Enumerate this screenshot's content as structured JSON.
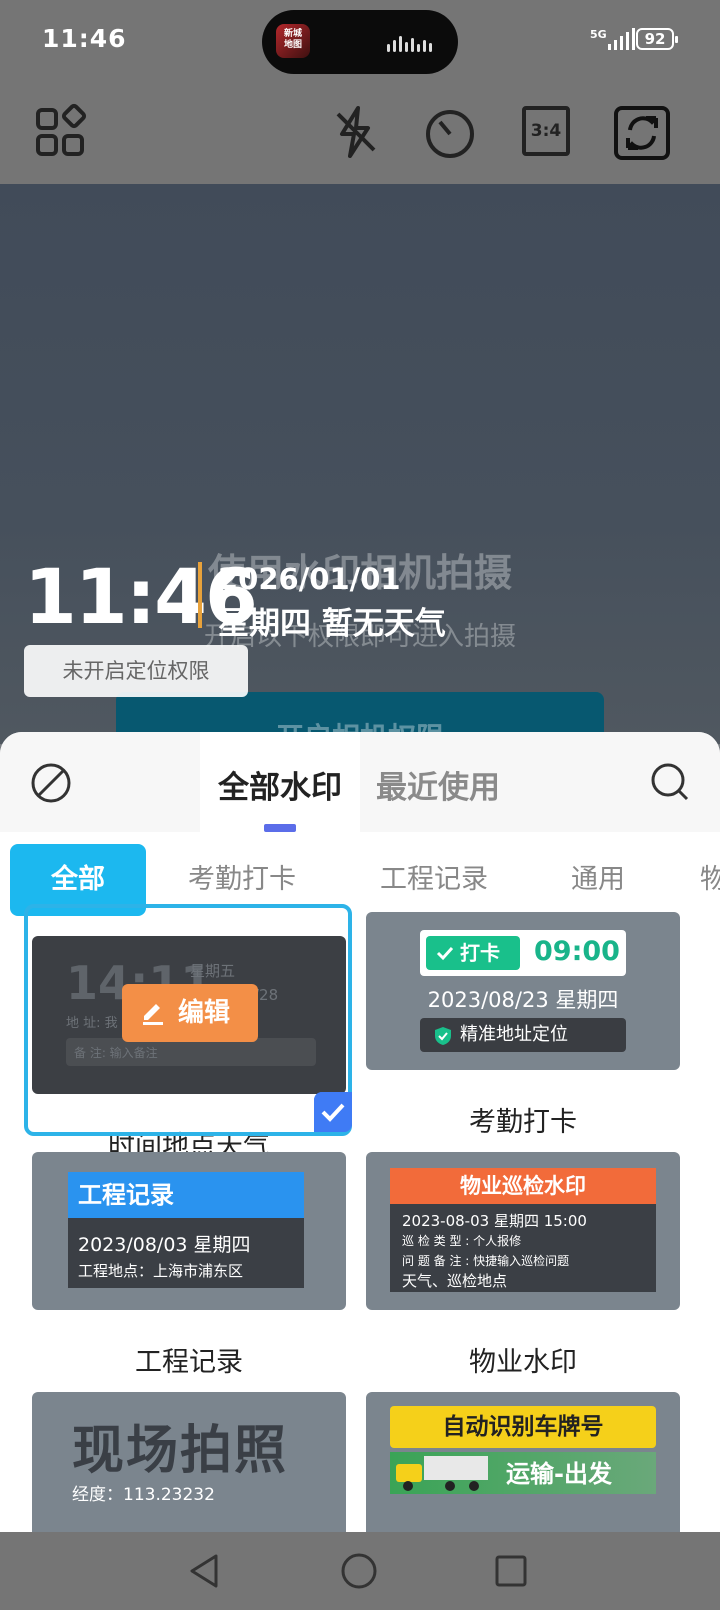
{
  "status_bar": {
    "time": "11:46",
    "network": "5G",
    "battery": "92",
    "island_app": "新城\n地图"
  },
  "camera": {
    "permission_title": "使用水印相机拍摄",
    "permission_subtitle": "开启以下权限即可进入拍摄",
    "permission_button": "开启相机权限",
    "ratio": "3:4"
  },
  "watermark": {
    "time": "11:46",
    "date": "2026/01/01",
    "weekday_weather": "星期四 暂无天气",
    "location": "未开启定位权限"
  },
  "sheet": {
    "tabs": [
      "全部水印",
      "最近使用"
    ],
    "categories": [
      "全部",
      "考勤打卡",
      "工程记录",
      "通用",
      "物"
    ],
    "cards": [
      {
        "label": "时间地点天气",
        "thumb": {
          "time": "14:11",
          "weekday": "星期五",
          "date": "/28",
          "address": "地 址: 我",
          "note": "备 注: 输入备注",
          "edit": "编辑"
        }
      },
      {
        "label": "考勤打卡",
        "thumb": {
          "tag": "打卡",
          "time": "09:00",
          "date": "2023/08/23 星期四",
          "location": "精准地址定位"
        }
      },
      {
        "label": "工程记录",
        "thumb": {
          "header": "工程记录",
          "date": "2023/08/03   星期四",
          "address": "工程地点：上海市浦东区"
        }
      },
      {
        "label": "物业水印",
        "thumb": {
          "header": "物业巡检水印",
          "line1": "2023-08-03 星期四 15:00",
          "line2": "巡 检 类 型 : 个人报修",
          "line3": "问 题 备 注 : 快捷输入巡检问题",
          "line4": "天气、巡检地点"
        }
      },
      {
        "label": "",
        "thumb": {
          "title": "现场拍照",
          "longitude": "经度：113.23232"
        }
      },
      {
        "label": "",
        "thumb": {
          "plate": "自动识别车牌号",
          "go": "运输-出发"
        }
      }
    ]
  },
  "icons": [
    "templates-icon",
    "flash-off-icon",
    "timer-icon",
    "ratio-icon",
    "switch-camera-icon",
    "no-watermark-icon",
    "search-icon",
    "edit-icon",
    "check-icon",
    "back-icon",
    "home-icon",
    "recents-icon"
  ],
  "colors": {
    "accent": "#1cb8ef",
    "tab_indicator": "#5b6de9",
    "edit": "#f38f47",
    "check": "#3f7bf5",
    "punch_green": "#19c08b"
  }
}
